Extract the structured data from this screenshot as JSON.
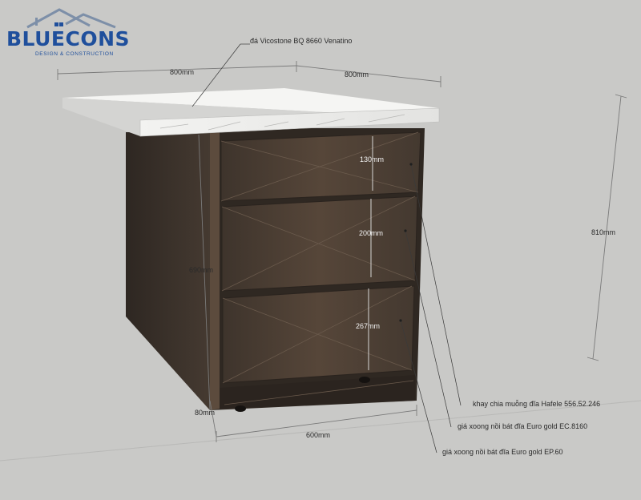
{
  "logo": {
    "name": "BLUECONS",
    "tagline": "DESIGN & CONSTRUCTION",
    "colors": {
      "brand": "#1f4f9c",
      "roof": "#7d8fa8"
    }
  },
  "annotations": {
    "countertop": "đá Vicostone BQ 8660 Venatino",
    "tray": "khay chia muỗng đĩa Hafele 556.52.246",
    "rack_middle": "giá xoong nồi bát đĩa Euro gold EC.8160",
    "rack_bottom": "giá xoong nồi bát đĩa Euro gold EP.60"
  },
  "dimensions": {
    "top_width_left": "800mm",
    "top_width_right": "800mm",
    "total_height": "810mm",
    "body_height": "690mm",
    "plinth_height": "80mm",
    "body_width": "600mm",
    "drawer_1": "130mm",
    "drawer_2": "200mm",
    "drawer_3": "267mm"
  },
  "colors": {
    "background": "#c9c9c7",
    "wood_front": "#4a3d33",
    "wood_side": "#3c332c",
    "stone": "#eeeeec",
    "dimension_line": "#7a7a7a"
  }
}
